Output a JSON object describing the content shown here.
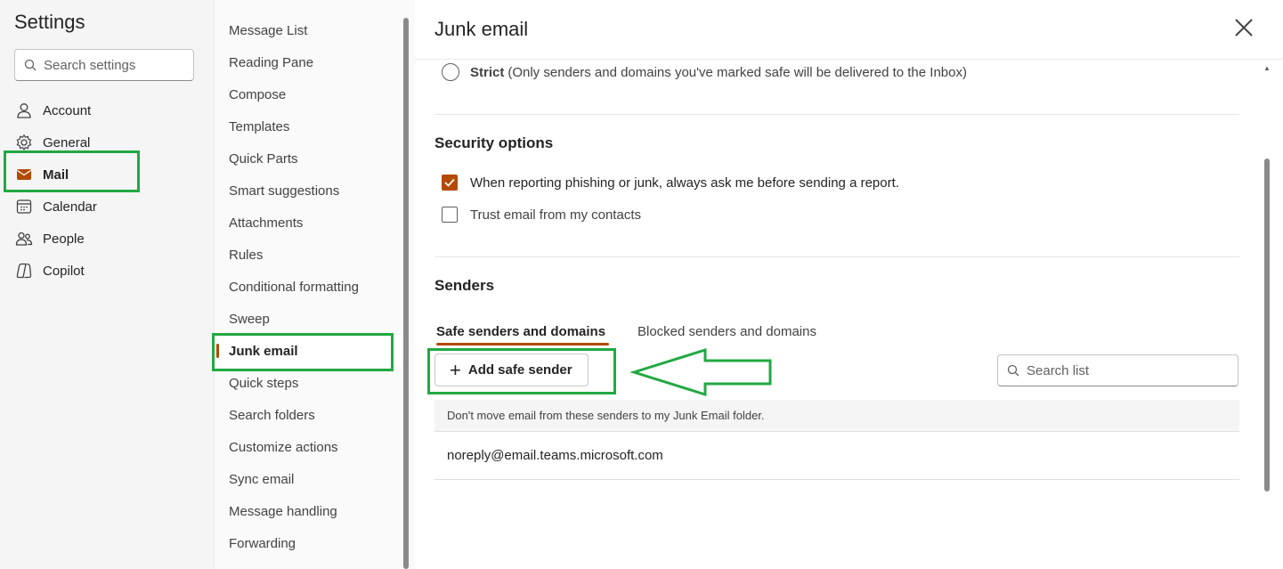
{
  "settings": {
    "title": "Settings",
    "search_placeholder": "Search settings"
  },
  "nav": {
    "items": [
      {
        "label": "Account",
        "icon": "person-icon"
      },
      {
        "label": "General",
        "icon": "gear-icon"
      },
      {
        "label": "Mail",
        "icon": "mail-icon",
        "active": true
      },
      {
        "label": "Calendar",
        "icon": "calendar-icon"
      },
      {
        "label": "People",
        "icon": "people-icon"
      },
      {
        "label": "Copilot",
        "icon": "copilot-icon"
      }
    ]
  },
  "mail_menu": {
    "items": [
      "Message List",
      "Reading Pane",
      "Compose",
      "Templates",
      "Quick Parts",
      "Smart suggestions",
      "Attachments",
      "Rules",
      "Conditional formatting",
      "Sweep",
      "Junk email",
      "Quick steps",
      "Search folders",
      "Customize actions",
      "Sync email",
      "Message handling",
      "Forwarding"
    ],
    "active_index": 10
  },
  "panel": {
    "title": "Junk email",
    "strict_label": "Strict",
    "strict_desc": "(Only senders and domains you've marked safe will be delivered to the Inbox)",
    "security_heading": "Security options",
    "security_opt1": "When reporting phishing or junk, always ask me before sending a report.",
    "security_opt1_checked": true,
    "security_opt2": "Trust email from my contacts",
    "security_opt2_checked": false,
    "senders_heading": "Senders",
    "tab_safe": "Safe senders and domains",
    "tab_blocked": "Blocked senders and domains",
    "add_button": "Add safe sender",
    "search_list_placeholder": "Search list",
    "list_header": "Don't move email from these senders to my Junk Email folder.",
    "list_items": [
      "noreply@email.teams.microsoft.com"
    ]
  },
  "colors": {
    "accent": "#b34a00",
    "highlight": "#22a843"
  }
}
